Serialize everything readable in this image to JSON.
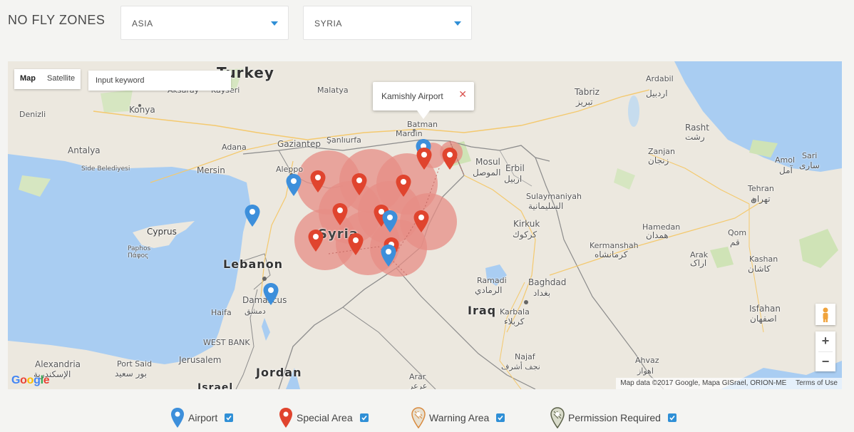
{
  "header": {
    "title": "NO FLY ZONES",
    "continent_select": {
      "value": "ASIA"
    },
    "country_select": {
      "value": "SYRIA"
    }
  },
  "map": {
    "type_control": {
      "map_label": "Map",
      "satellite_label": "Satellite",
      "active": "Map"
    },
    "search": {
      "placeholder": "Input keyword"
    },
    "info_window": {
      "text": "Kamishly Airport",
      "close_glyph": "✕"
    },
    "zoom_in": "+",
    "zoom_out": "−",
    "attribution": "Map data ©2017 Google, Mapa GISrael, ORION-ME",
    "terms": "Terms of Use",
    "logo": "Google",
    "labels": {
      "turkey": "Turkey",
      "aksaray": "Aksaray",
      "kayseri": "Kayseri",
      "malatya": "Malatya",
      "konya": "Konya",
      "denizli": "Denizli",
      "antalya": "Antalya",
      "adana": "Adana",
      "gaziantep": "Gaziantep",
      "sanliurfa": "Şanlıurfa",
      "batman": "Batman",
      "mardin": "Mardin",
      "side": "Side Belediyesi",
      "mersin": "Mersin",
      "aleppo": "Aleppo",
      "mosul": "Mosul",
      "mosul_ar": "الموصل",
      "erbil": "Erbil",
      "erbil_ar": "اربيل",
      "tabriz": "Tabriz",
      "tabriz_ar": "تبریز",
      "ardabil": "Ardabil",
      "ardabil_ar": "اردبیل",
      "rasht": "Rasht",
      "rasht_ar": "رشت",
      "zanjan": "Zanjan",
      "zanjan_ar": "زنجان",
      "amol": "Amol",
      "amol_ar": "آمل",
      "sari": "Sari",
      "sari_ar": "ساری",
      "tehran": "Tehran",
      "tehran_ar": "تهران",
      "sulaymaniyah": "Sulaymaniyah",
      "sulaymaniyah_ar": "السليمانية",
      "kirkuk": "Kirkuk",
      "kirkuk_ar": "كركوك",
      "hamedan": "Hamedan",
      "hamedan_ar": "همدان",
      "qom": "Qom",
      "qom_ar": "قم",
      "kermanshah": "Kermanshah",
      "kermanshah_ar": "کرمانشاه",
      "arak": "Arak",
      "arak_ar": "اراک",
      "kashan": "Kashan",
      "kashan_ar": "کاشان",
      "cyprus": "Cyprus",
      "paphos": "Paphos",
      "paphos_gr": "Πάφος",
      "syria": "Syria",
      "lebanon": "Lebanon",
      "damascus": "Damascus",
      "damascus_ar": "دمشق",
      "haifa": "Haifa",
      "ramadi": "Ramadi",
      "ramadi_ar": "الرمادي",
      "baghdad": "Baghdad",
      "baghdad_ar": "بغداد",
      "iraq": "Iraq",
      "karbala": "Karbala",
      "karbala_ar": "كربلاء",
      "isfahan": "Isfahan",
      "isfahan_ar": "اصفهان",
      "westbank": "WEST BANK",
      "alexandria": "Alexandria",
      "alexandria_ar": "الإسكندرية",
      "portsaid": "Port Said",
      "portsaid_ar": "بور سعيد",
      "jerusalem": "Jerusalem",
      "jordan": "Jordan",
      "israel": "Israel",
      "arar": "Arar",
      "arar_ar": "عرعر",
      "najaf": "Najaf",
      "najaf_ar": "نجف أشرف",
      "ahvaz": "Ahvaz",
      "ahvaz_ar": "اهواز"
    },
    "colors": {
      "airport": "#3d8fdb",
      "special_area": "#e0442e",
      "zone_fill": "#e78e86",
      "water": "#a9cdf2"
    }
  },
  "legend": {
    "airport": "Airport",
    "special_area": "Special Area",
    "warning_area": "Warning Area",
    "permission_required": "Permission Required"
  }
}
